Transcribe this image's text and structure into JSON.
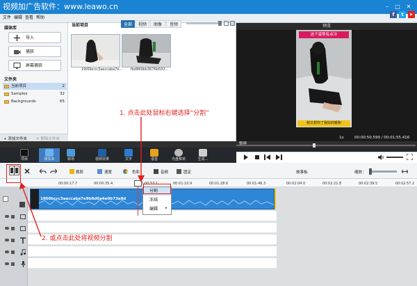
{
  "window": {
    "title": "视频加广告软件：www.leawo.cn",
    "minimize": "–",
    "maximize": "□",
    "close": "✕"
  },
  "menu": {
    "items": [
      "文件",
      "编辑",
      "查看",
      "帮助"
    ]
  },
  "social": {
    "facebook": "f",
    "twitter": "t",
    "youtube": "▶"
  },
  "media_library": {
    "heading": "媒体库",
    "buttons": [
      {
        "label": "导入",
        "icon": "plus-icon"
      },
      {
        "label": "捕获",
        "icon": "camera-icon"
      },
      {
        "label": "屏幕捕获",
        "icon": "screen-icon"
      }
    ],
    "folders_heading": "文件夹",
    "folders": [
      {
        "name": "当前项目",
        "count": "2"
      },
      {
        "name": "Samples",
        "count": "32"
      },
      {
        "name": "Backgrounds",
        "count": "65"
      }
    ],
    "add_folder": "+ 添加文件夹",
    "delete_folder": "✕ 删除文件夹"
  },
  "library": {
    "heading": "当前项目",
    "tabs": [
      "全部",
      "视频",
      "图像",
      "音频"
    ],
    "active_tab": 0,
    "items": [
      {
        "label": "1900bccc3aeccaba7e..."
      },
      {
        "label": "fbd869bb3676b502..."
      }
    ]
  },
  "preview": {
    "heading": "预览",
    "caption_top": "这个姿势有点冷",
    "caption_bottom": "我又想你了我好的暖和",
    "state": "暂停",
    "speed": "1x",
    "timecode": "00:00:50.599 / 00:01:55.416"
  },
  "modules": [
    {
      "label": "项目"
    },
    {
      "label": "媒体库"
    },
    {
      "label": "转场"
    },
    {
      "label": "视频效果"
    },
    {
      "label": "文字"
    },
    {
      "label": "语音"
    },
    {
      "label": "光盘菜单"
    },
    {
      "label": "生成..."
    }
  ],
  "edit_toolbar": {
    "crop": "裁剪",
    "speed": "速度",
    "color": "色彩",
    "audio": "音频",
    "freeze": "固定",
    "storyboard": "故事板",
    "zoom": "缩放："
  },
  "ruler": {
    "ticks": [
      "00:00:17.7",
      "00:00:35.4",
      "00:00:53.1",
      "00:01:10.9",
      "00:01:28.6",
      "00:01:46.3",
      "00:02:04.0",
      "00:02:21.8",
      "00:02:39.5",
      "00:02:57.2"
    ]
  },
  "timeline": {
    "clip_title": "1900bccc3aeccaba7e9b8d6a4e0b73a8d",
    "context_menu": [
      "分割",
      "冻结",
      "编辑"
    ]
  },
  "annotations": {
    "note1": "1. 点击此处鼠标右键选择“分割”",
    "note2": "2. 或点击此处将视频分割"
  },
  "colors": {
    "title_bar": "#1b83d3",
    "annotation_red": "#e0201b",
    "clip_blue": "#2e86d6"
  }
}
